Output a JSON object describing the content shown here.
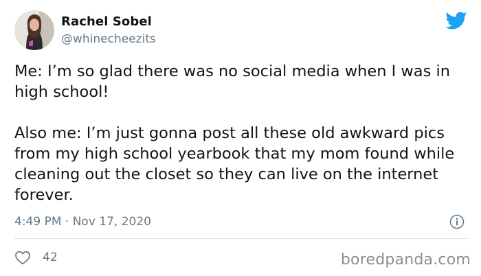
{
  "author": {
    "display_name": "Rachel Sobel",
    "handle": "@whinecheezits"
  },
  "tweet": {
    "paragraphs": [
      "Me: I’m so glad there was no social media when I was in high school!",
      "Also me: I’m just gonna post all these old awkward pics from my high school yearbook that my mom found while cleaning out the closet so they can live on the internet forever."
    ],
    "timestamp": "4:49 PM · Nov 17, 2020"
  },
  "engagement": {
    "likes": "42"
  },
  "watermark": "boredpanda.com",
  "icons": {
    "logo": "twitter-bird-icon",
    "info": "info-icon",
    "like": "heart-icon"
  },
  "colors": {
    "twitter_blue": "#1da1f2",
    "text": "#0f1419",
    "secondary_text": "#657786",
    "divider": "#d7dee3",
    "watermark": "#8a8f93"
  }
}
